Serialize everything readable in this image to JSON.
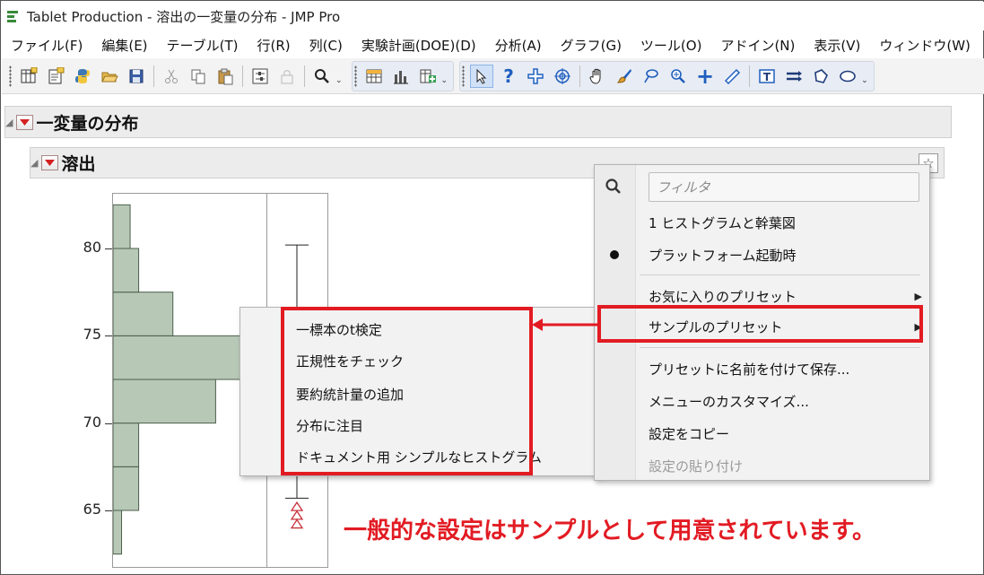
{
  "window": {
    "title": "Tablet Production - 溶出の一変量の分布 - JMP Pro"
  },
  "menubar": {
    "items": [
      "ファイル(F)",
      "編集(E)",
      "テーブル(T)",
      "行(R)",
      "列(C)",
      "実験計画(DOE)(D)",
      "分析(A)",
      "グラフ(G)",
      "ツール(O)",
      "アドイン(N)",
      "表示(V)",
      "ウィンドウ(W)"
    ]
  },
  "toolbar": {
    "icons": [
      "new-data-table-icon",
      "open-script-icon",
      "python-icon",
      "open-folder-icon",
      "save-icon",
      "cut-icon",
      "copy-icon",
      "paste-icon",
      "report-options-icon",
      "lock-icon",
      "search-icon",
      "tabulate-icon",
      "graph-builder-icon",
      "add-column-icon",
      "arrow-select-icon",
      "help-icon",
      "crosshair-icon",
      "target-icon",
      "grabber-hand-icon",
      "brush-icon",
      "lasso-icon",
      "magnifier-icon",
      "plus-icon",
      "ruler-icon",
      "text-annotation-icon",
      "line-annotation-icon",
      "polygon-icon",
      "ellipse-icon"
    ],
    "selected_tool": "arrow-select-icon"
  },
  "report": {
    "outline_title": "一変量の分布",
    "sub_title": "溶出"
  },
  "chart_data": {
    "type": "bar",
    "orientation": "horizontal-histogram",
    "y_ticks": [
      "80",
      "75",
      "70",
      "65"
    ],
    "ylim": [
      62,
      84
    ],
    "bins": [
      {
        "from": 62.5,
        "to": 65,
        "count": 1
      },
      {
        "from": 65,
        "to": 67.5,
        "count": 3
      },
      {
        "from": 67.5,
        "to": 70,
        "count": 3
      },
      {
        "from": 70,
        "to": 72.5,
        "count": 12
      },
      {
        "from": 72.5,
        "to": 75,
        "count": 15
      },
      {
        "from": 75,
        "to": 77.5,
        "count": 7
      },
      {
        "from": 77.5,
        "to": 80,
        "count": 3
      },
      {
        "from": 80,
        "to": 82.5,
        "count": 2
      }
    ],
    "box_plot": {
      "upper_whisker": 80.2,
      "lower_whisker": 65.7,
      "outliers": [
        65.2,
        64.7,
        64.2
      ]
    },
    "colors": {
      "bar_fill": "#b7c8b7",
      "bar_stroke": "#4b5e4b",
      "outlier": "#c8323c"
    }
  },
  "context_menu": {
    "filter_placeholder": "フィルタ",
    "items": [
      {
        "label": "1 ヒストグラムと幹葉図"
      },
      {
        "label": "プラットフォーム起動時",
        "checked": true
      },
      {
        "label": "お気に入りのプリセット",
        "submenu": true
      },
      {
        "label": "サンプルのプリセット",
        "submenu": true,
        "highlighted": true
      },
      {
        "label": "プリセットに名前を付けて保存..."
      },
      {
        "label": "メニューのカスタマイズ..."
      },
      {
        "label": "設定をコピー"
      },
      {
        "label": "設定の貼り付け",
        "disabled": true
      }
    ]
  },
  "sample_presets_submenu": {
    "items": [
      "一標本のt検定",
      "正規性をチェック",
      "要約統計量の追加",
      "分布に注目",
      "ドキュメント用 シンプルなヒストグラム"
    ]
  },
  "annotation": {
    "caption": "一般的な設定はサンプルとして用意されています。",
    "highlight_color": "#e21b23"
  }
}
